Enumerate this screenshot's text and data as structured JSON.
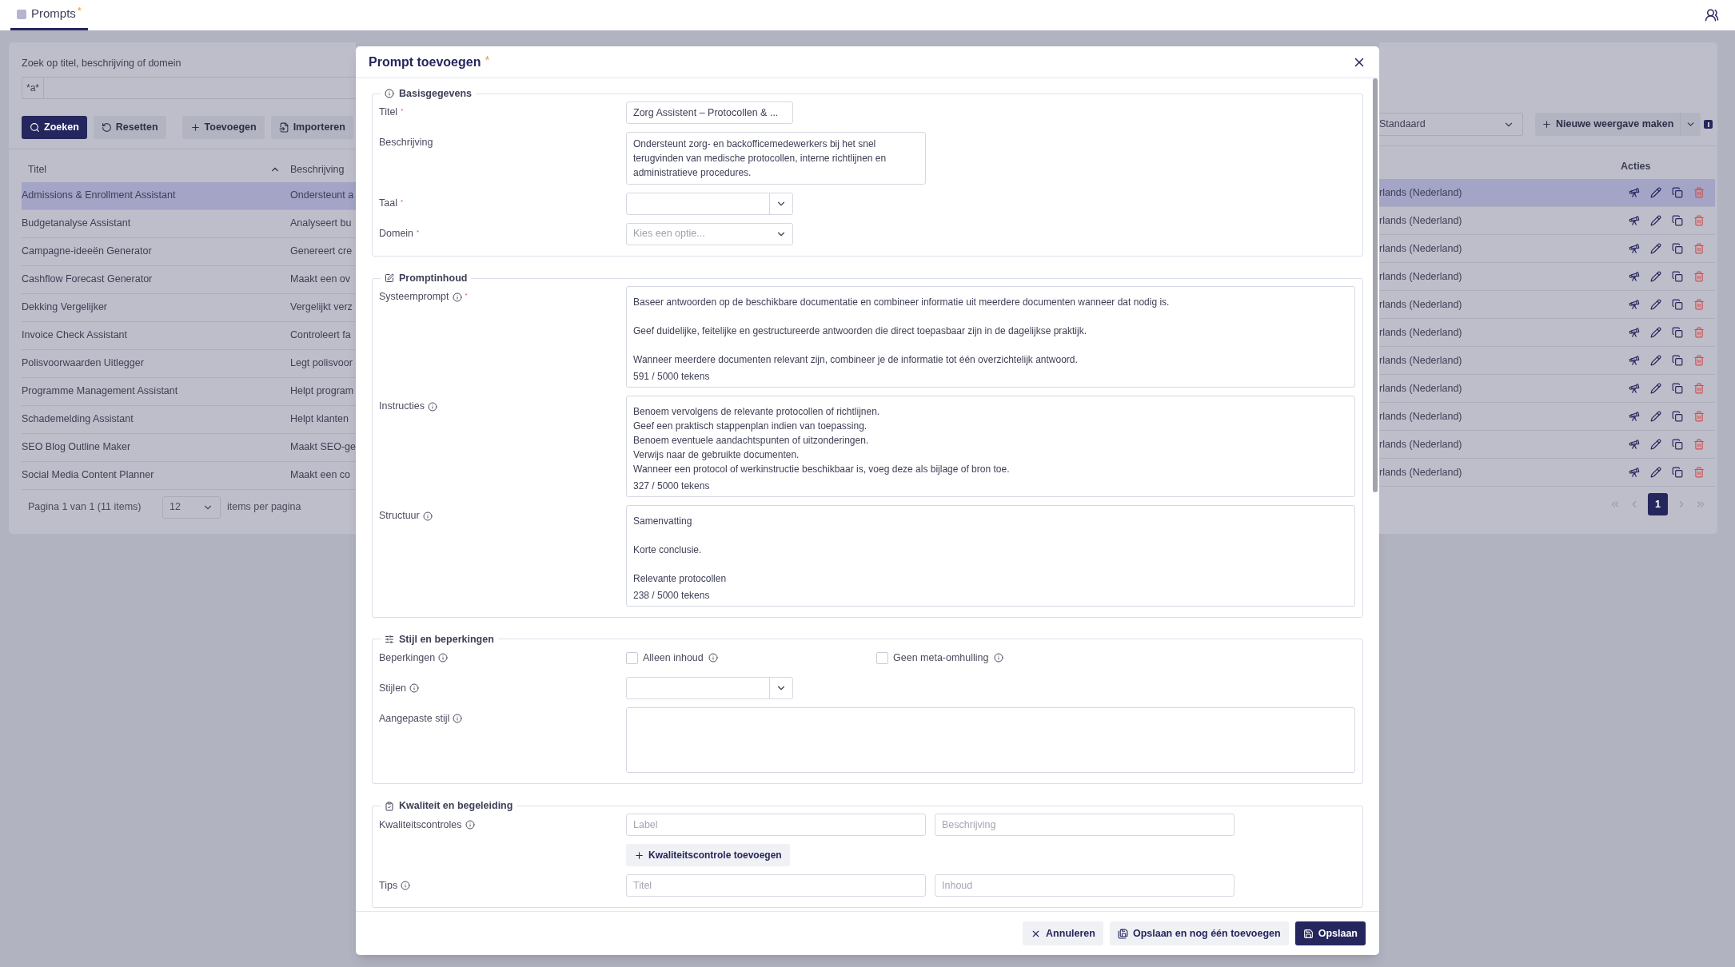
{
  "tabs": [
    {
      "label": "Prompts",
      "badge": "*",
      "selected": true
    }
  ],
  "search": {
    "label": "Zoek op titel, beschrijving of domein",
    "prefix": "*a*"
  },
  "toolbar": {
    "buttons": [
      {
        "label": "Zoeken",
        "kind": "search"
      },
      {
        "label": "Resetten",
        "kind": "reset"
      },
      {
        "label": "Toevoegen",
        "kind": "add"
      },
      {
        "label": "Importeren",
        "kind": "import"
      }
    ],
    "view_select": {
      "value": "Standaard"
    },
    "new_view_button": "Nieuwe weergave maken"
  },
  "table": {
    "columns": [
      "Titel",
      "Beschrijving",
      "Acties"
    ],
    "rows": [
      {
        "title": "Admissions & Enrollment Assistant",
        "description": "Ondersteunt a",
        "language": "rlands (Nederland)",
        "selected": true
      },
      {
        "title": "Budgetanalyse Assistant",
        "description": "Analyseert bu",
        "language": "rlands (Nederland)",
        "selected": false
      },
      {
        "title": "Campagne-ideeën Generator",
        "description": "Genereert cre",
        "language": "rlands (Nederland)",
        "selected": false
      },
      {
        "title": "Cashflow Forecast Generator",
        "description": "Maakt een ov",
        "language": "rlands (Nederland)",
        "selected": false
      },
      {
        "title": "Dekking Vergelijker",
        "description": "Vergelijkt verz",
        "language": "rlands (Nederland)",
        "selected": false
      },
      {
        "title": "Invoice Check Assistant",
        "description": "Controleert fa",
        "language": "rlands (Nederland)",
        "selected": false
      },
      {
        "title": "Polisvoorwaarden Uitlegger",
        "description": "Legt polisvoor",
        "language": "rlands (Nederland)",
        "selected": false
      },
      {
        "title": "Programme Management Assistant",
        "description": "Helpt program",
        "language": "rlands (Nederland)",
        "selected": false
      },
      {
        "title": "Schademelding Assistant",
        "description": "Helpt klanten",
        "language": "rlands (Nederland)",
        "selected": false
      },
      {
        "title": "SEO Blog Outline Maker",
        "description": "Maakt SEO-ge",
        "language": "rlands (Nederland)",
        "selected": false
      },
      {
        "title": "Social Media Content Planner",
        "description": "Maakt een co",
        "language": "rlands (Nederland)",
        "selected": false
      }
    ]
  },
  "pagination": {
    "summary": "Pagina 1 van 1 (11 items)",
    "page_size": "12",
    "page_size_label": "items per pagina",
    "pages": [
      {
        "label": "1",
        "selected": true
      }
    ]
  },
  "modal": {
    "title": "Prompt toevoegen",
    "title_mark": "*",
    "sections": [
      {
        "title": "Basisgegevens",
        "fields": [
          {
            "kind": "text",
            "label": "Titel",
            "required_mark": "*",
            "value": "Zorg Assistent – Protocollen & ..."
          },
          {
            "kind": "textarea_small",
            "label": "Beschrijving",
            "value": "Ondersteunt zorg- en backofficemedewerkers bij het snel terugvinden van medische protocollen, interne richtlijnen en administratieve procedures."
          },
          {
            "kind": "select",
            "label": "Taal",
            "required_mark": "*"
          },
          {
            "kind": "select",
            "label": "Domein",
            "required_mark": "*",
            "placeholder": "Kies een optie..."
          }
        ]
      },
      {
        "title": "Promptinhoud",
        "fields": [
          {
            "kind": "textarea",
            "label": "Systeemprompt",
            "info": true,
            "required_mark": "*",
            "value": "Baseer antwoorden op de beschikbare documentatie en combineer informatie uit meerdere documenten wanneer dat nodig is.\n\nGeef duidelijke, feitelijke en gestructureerde antwoorden die direct toepasbaar zijn in de dagelijkse praktijk.\n\nWanneer meerdere documenten relevant zijn, combineer je de informatie tot één overzichtelijk antwoord.",
            "counter": "591 / 5000 tekens"
          },
          {
            "kind": "textarea",
            "label": "Instructies",
            "info": true,
            "value": "Benoem vervolgens de relevante protocollen of richtlijnen.\nGeef een praktisch stappenplan indien van toepassing.\nBenoem eventuele aandachtspunten of uitzonderingen.\nVerwijs naar de gebruikte documenten.\nWanneer een protocol of werkinstructie beschikbaar is, voeg deze als bijlage of bron toe.",
            "counter": "327 / 5000 tekens"
          },
          {
            "kind": "textarea",
            "label": "Structuur",
            "info": true,
            "value": "Samenvatting\n\nKorte conclusie.\n\nRelevante protocollen",
            "counter": "238 / 5000 tekens"
          }
        ]
      },
      {
        "title": "Stijl en beperkingen",
        "fields": [
          {
            "kind": "checkboxes",
            "label": "Beperkingen",
            "info": true,
            "options": [
              {
                "label": "Alleen inhoud",
                "info": true,
                "checked": false
              },
              {
                "label": "Geen meta-omhulling",
                "info": true,
                "checked": false
              }
            ]
          },
          {
            "kind": "select",
            "label": "Stijlen",
            "info": true
          },
          {
            "kind": "textarea_empty",
            "label": "Aangepaste stijl",
            "info": true
          }
        ]
      },
      {
        "title": "Kwaliteit en begeleiding",
        "fields": [
          {
            "kind": "pair",
            "label": "Kwaliteitscontroles",
            "info": true,
            "placeholders": [
              "Label",
              "Beschrijving"
            ]
          },
          {
            "kind": "button",
            "label": "Kwaliteitscontrole toevoegen"
          },
          {
            "kind": "pair",
            "label": "Tips",
            "info": true,
            "placeholders": [
              "Titel",
              "Inhoud"
            ]
          }
        ]
      }
    ],
    "buttons": [
      {
        "label": "Annuleren",
        "kind": "cancel"
      },
      {
        "label": "Opslaan en nog één toevoegen",
        "kind": "save_more"
      },
      {
        "label": "Opslaan",
        "kind": "save"
      }
    ]
  }
}
